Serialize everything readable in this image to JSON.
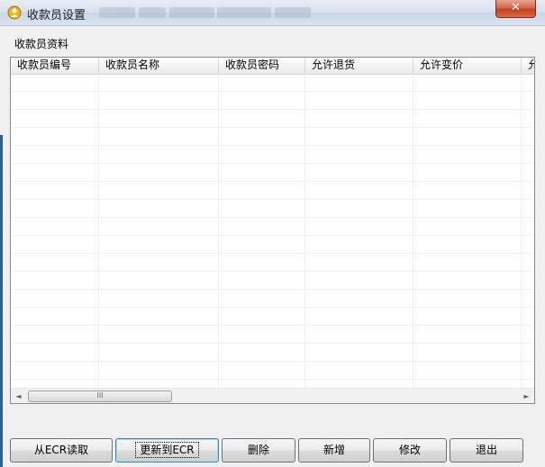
{
  "window": {
    "title": "收款员设置",
    "close_glyph": "✕"
  },
  "group": {
    "label": "收款员资料"
  },
  "table": {
    "columns": [
      "收款员编号",
      "收款员名称",
      "收款员密码",
      "允许退货",
      "允许变价",
      "允"
    ]
  },
  "scrollbar": {
    "left_arrow": "◄",
    "right_arrow": "►",
    "thumb_grip": "III"
  },
  "buttons": {
    "read": "从ECR读取",
    "update": "更新到ECR",
    "delete": "删除",
    "add": "新增",
    "edit": "修改",
    "exit": "退出"
  }
}
